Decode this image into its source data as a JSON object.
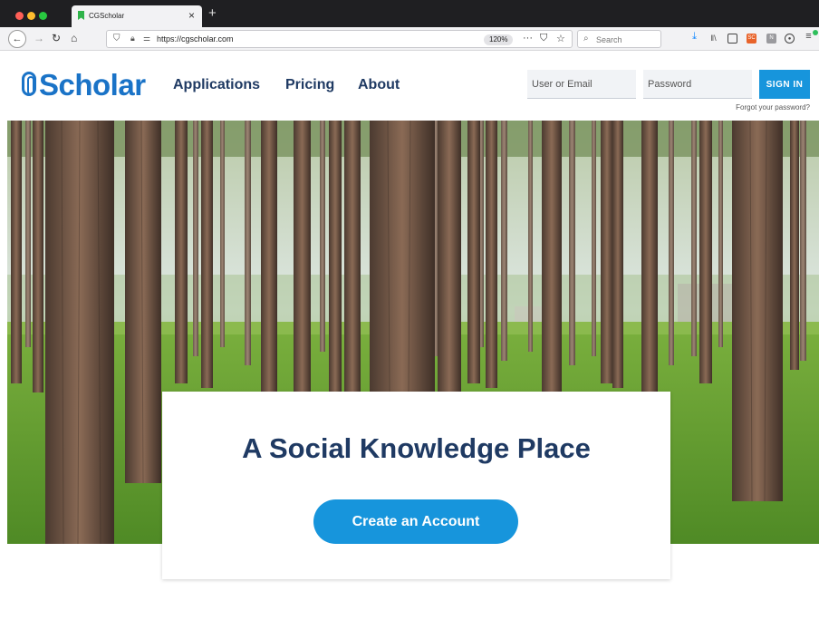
{
  "browser": {
    "tab_title": "CGScholar",
    "url": "https://cgscholar.com",
    "zoom": "120%",
    "search_placeholder": "Search"
  },
  "site": {
    "logo_text": "Scholar",
    "nav": [
      "Applications",
      "Pricing",
      "About"
    ],
    "login": {
      "user_placeholder": "User or Email",
      "password_placeholder": "Password",
      "signin_label": "SIGN IN",
      "forgot_label": "Forgot your password?"
    }
  },
  "hero": {
    "title": "A Social Knowledge Place",
    "cta_label": "Create an Account"
  },
  "colors": {
    "brand_blue": "#1a73c7",
    "button_blue": "#1795dc",
    "nav_navy": "#1f3a63"
  }
}
